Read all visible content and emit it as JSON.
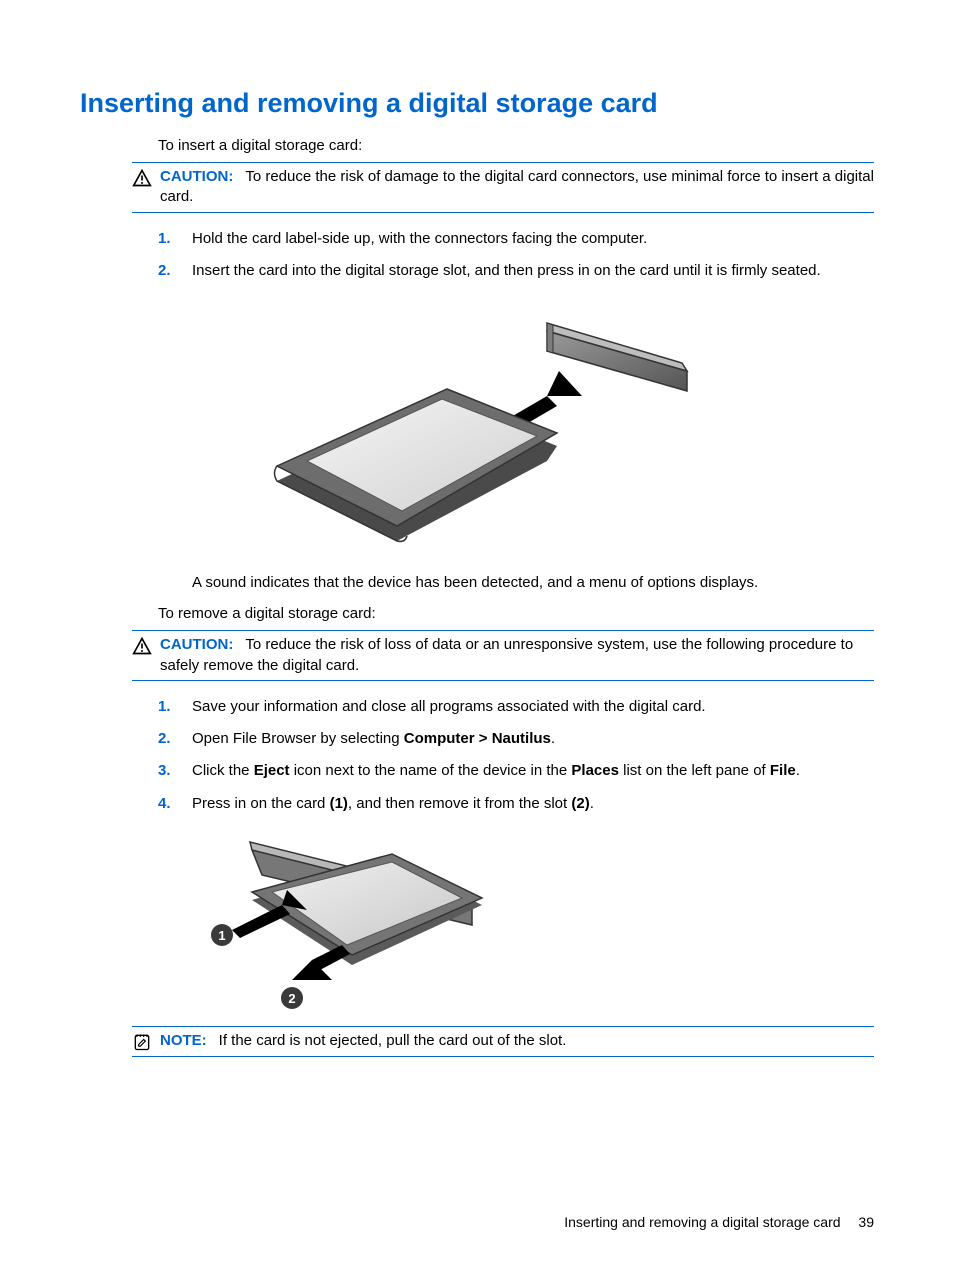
{
  "title": "Inserting and removing a digital storage card",
  "intro_insert": "To insert a digital storage card:",
  "caution1": {
    "label": "CAUTION:",
    "text": "To reduce the risk of damage to the digital card connectors, use minimal force to insert a digital card."
  },
  "insert_steps": {
    "s1": "Hold the card label-side up, with the connectors facing the computer.",
    "s2": "Insert the card into the digital storage slot, and then press in on the card until it is firmly seated."
  },
  "detection_text": "A sound indicates that the device has been detected, and a menu of options displays.",
  "intro_remove": "To remove a digital storage card:",
  "caution2": {
    "label": "CAUTION:",
    "text": "To reduce the risk of loss of data or an unresponsive system, use the following procedure to safely remove the digital card."
  },
  "remove_steps": {
    "s1": "Save your information and close all programs associated with the digital card.",
    "s2_pre": "Open File Browser by selecting ",
    "s2_bold": "Computer > Nautilus",
    "s2_post": ".",
    "s3_pre": "Click the ",
    "s3_b1": "Eject",
    "s3_mid1": " icon next to the name of the device in the ",
    "s3_b2": "Places",
    "s3_mid2": " list on the left pane of ",
    "s3_b3": "File",
    "s3_post": ".",
    "s4_pre": "Press in on the card ",
    "s4_b1": "(1)",
    "s4_mid": ", and then remove it from the slot ",
    "s4_b2": "(2)",
    "s4_post": "."
  },
  "note": {
    "label": "NOTE:",
    "text": "If the card is not ejected, pull the card out of the slot."
  },
  "footer": {
    "text": "Inserting and removing a digital storage card",
    "page": "39"
  }
}
